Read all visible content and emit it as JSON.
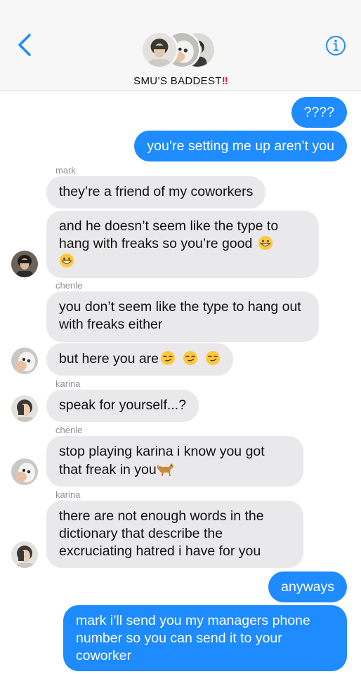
{
  "header": {
    "title": "SMU’S BADDEST",
    "title_suffix": "‼",
    "back_icon": "chevron-left-icon",
    "info_icon": "info-icon",
    "accent": "#1e8bff"
  },
  "messages": [
    {
      "from": "me",
      "text": "????"
    },
    {
      "from": "me",
      "text": "you’re setting me up aren’t you"
    },
    {
      "sender": "mark",
      "text": "they’re a friend of my coworkers"
    },
    {
      "sender": "mark",
      "text": "and he doesn’t seem like the type to hang with freaks so you’re good",
      "emoji": [
        "grinning-face",
        "grinning-face"
      ]
    },
    {
      "sender": "chenle",
      "text": "you don’t seem like the type to hang out with freaks either"
    },
    {
      "sender": "chenle",
      "text": "but here you are",
      "emoji": [
        "smirking-face",
        "smirking-face",
        "smirking-face"
      ]
    },
    {
      "sender": "karina",
      "text": "speak for yourself...?"
    },
    {
      "sender": "chenle",
      "text": "stop playing karina i know you got that freak in you",
      "emoji": [
        "dog"
      ]
    },
    {
      "sender": "karina",
      "text": "there are not enough words in the dictionary that describe the excruciating hatred i have for you"
    },
    {
      "from": "me",
      "text": "anyways"
    },
    {
      "from": "me",
      "text": "mark i’ll send you my managers phone number so you can send it to your coworker"
    }
  ],
  "colors": {
    "outgoing_bubble": "#1e8bff",
    "incoming_bubble": "#e9e9eb",
    "sender_label": "#8e8e93"
  }
}
